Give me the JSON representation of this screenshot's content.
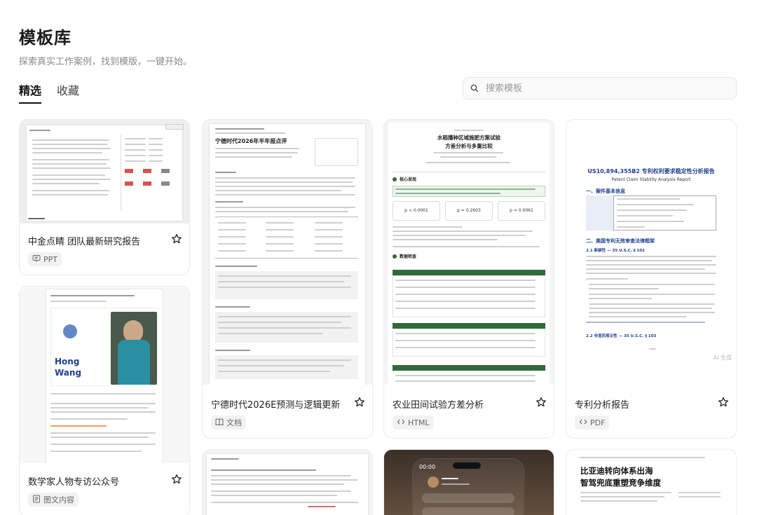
{
  "header": {
    "title": "模板库",
    "subtitle": "探索真实工作案例，找到模版，一键开始。"
  },
  "tabs": [
    {
      "label": "精选",
      "active": true
    },
    {
      "label": "收藏",
      "active": false
    }
  ],
  "search": {
    "placeholder": "搜索模板"
  },
  "cards": [
    {
      "name": "中金点睛 团队最新研究报告",
      "type": "PPT",
      "icon": "presentation-icon"
    },
    {
      "name": "宁德时代2026E预测与逻辑更新",
      "type": "文档",
      "icon": "book-icon"
    },
    {
      "name": "农业田间试验方差分析",
      "type": "HTML",
      "icon": "code-icon"
    },
    {
      "name": "专利分析报告",
      "type": "PDF",
      "icon": "code-icon"
    },
    {
      "name": "数学家人物专访公众号",
      "type": "图文内容",
      "icon": "doc-image-icon"
    }
  ],
  "thumbs": {
    "card2_title": "宁德时代2026年半年报点评",
    "card3_title": "水稻播种区域施肥方案试验",
    "card3_sub": "方差分析与多重比较",
    "card3_stats": [
      "p < 0.0001",
      "p = 0.2603",
      "p = 0.0061"
    ],
    "card3_sections": [
      "核心发现",
      "数据检查"
    ],
    "card4_title": "US10,894,355B2 专利权利要求稳定性分析报告",
    "card4_subtitle": "Patent Claim Stability Analysis Report",
    "card4_section1": "一、案件基本信息",
    "card4_section2": "二、美国专利无效审查法律框架",
    "card4_sub21": "2.1 新颖性 — 35 U.S.C. § 102",
    "card4_sub22": "2.2 非显而易见性 — 35 U.S.C. § 103",
    "card4_watermark": "AI 生成",
    "card5_name_line1": "Hong",
    "card5_name_line2": "Wang",
    "card8_title_line1": "比亚迪转向体系出海",
    "card8_title_line2": "智驾兜底重塑竞争维度",
    "card7_time": "00:00"
  },
  "colors": {
    "accent": "#111111",
    "green": "#2f6b3a",
    "blue": "#1f3f8f",
    "star": "#222222"
  }
}
